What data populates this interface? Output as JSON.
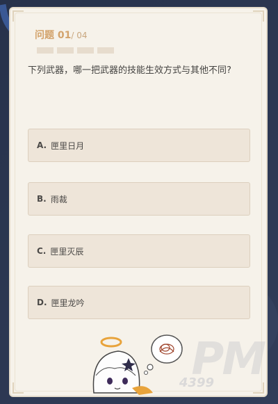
{
  "quiz": {
    "header_label": "问题",
    "current": "01",
    "total": "/ 04",
    "question": "下列武器，哪一把武器的技能生效方式与其他不同?",
    "progress_segments": 4,
    "options": [
      {
        "letter": "A.",
        "text": "匣里日月"
      },
      {
        "letter": "B.",
        "text": "雨裁"
      },
      {
        "letter": "C.",
        "text": "匣里灭辰"
      },
      {
        "letter": "D.",
        "text": "匣里龙吟"
      }
    ]
  },
  "watermark": {
    "logo_text": "PM",
    "sub_text": "4399"
  },
  "colors": {
    "card_bg": "#f6f2ea",
    "option_bg": "#eee5d9",
    "accent": "#d3a36c",
    "page_bg": "#2a3550"
  }
}
